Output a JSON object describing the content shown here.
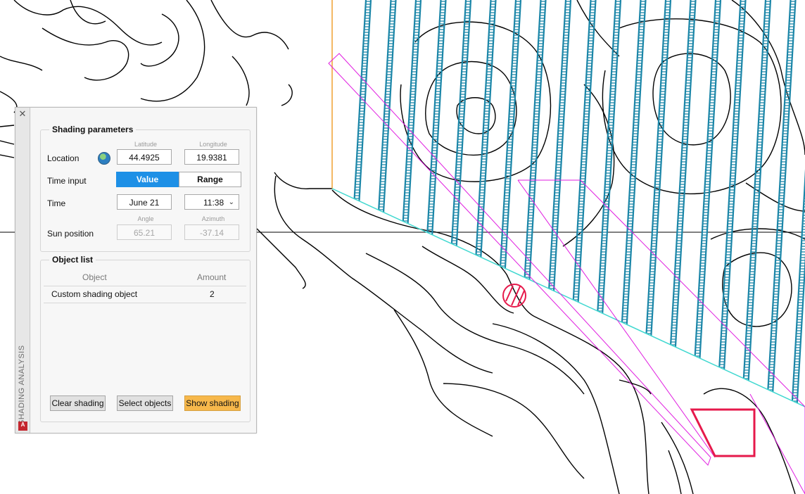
{
  "palette": {
    "vertical_title": "SHADING ANALYSIS",
    "close_glyph": "✕",
    "app_logo_letter": "A"
  },
  "shading_parameters": {
    "title": "Shading parameters",
    "location_label": "Location",
    "latitude_caption": "Latitude",
    "longitude_caption": "Longitude",
    "latitude": "44.4925",
    "longitude": "19.9381",
    "time_input_label": "Time input",
    "time_input_options": [
      "Value",
      "Range"
    ],
    "time_input_selected": "Value",
    "time_label": "Time",
    "date": "June 21",
    "time": "11:38",
    "sun_position_label": "Sun position",
    "angle_caption": "Angle",
    "azimuth_caption": "Azimuth",
    "angle": "65.21",
    "azimuth": "-37.14"
  },
  "object_list": {
    "title": "Object list",
    "columns": [
      "Object",
      "Amount"
    ],
    "rows": [
      {
        "object": "Custom shading object",
        "amount": "2"
      }
    ]
  },
  "buttons": {
    "clear": "Clear shading",
    "select": "Select objects",
    "show": "Show shading"
  },
  "colors": {
    "accent_blue": "#1e90e6",
    "show_button": "#f7b84b",
    "shading_blue": "#1b86a8",
    "outline_magenta": "#e01ee0",
    "shape_red": "#e6194b",
    "cyan_edge": "#40d8d0",
    "orange_edge": "#f0a030"
  }
}
